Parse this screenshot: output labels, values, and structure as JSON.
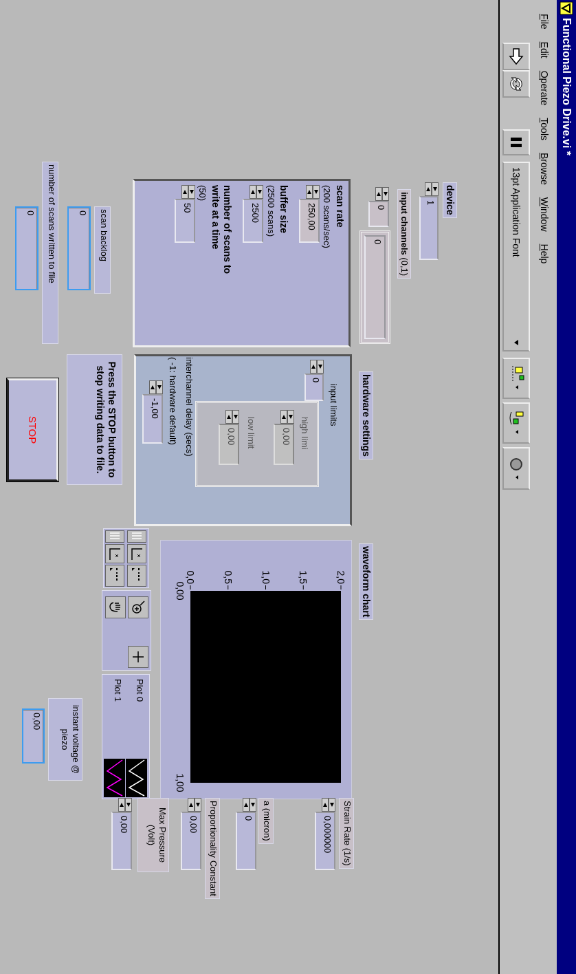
{
  "window": {
    "title": "Functional Piezo Drive.vi *"
  },
  "menu": [
    "File",
    "Edit",
    "Operate",
    "Tools",
    "Browse",
    "Window",
    "Help"
  ],
  "toolbar": {
    "font": "13pt Application Font"
  },
  "device": {
    "label": "device",
    "value": "1"
  },
  "input_channels": {
    "label": "**input channels** (0,1)",
    "index": "0",
    "value": "0"
  },
  "scan_settings": [
    {
      "label": "scan rate",
      "hint": "(200 scans/sec)",
      "value": "250,00"
    },
    {
      "label": "buffer size",
      "hint": "(2500 scans)",
      "value": "2500"
    },
    {
      "label": "number of scans to write at a time",
      "hint": "(50)",
      "value": "50"
    }
  ],
  "hardware_settings": {
    "label": "hardware settings",
    "input_limits": {
      "label": "input limits",
      "index": "0",
      "items": [
        {
          "label": "high limi",
          "value": "0,00",
          "disabled": true
        },
        {
          "label": "low limit",
          "value": "0,00",
          "disabled": true
        }
      ]
    },
    "delay": {
      "label": "interchannel delay (secs)",
      "hint": "( -1: hardware default)",
      "value": "-1,00"
    }
  },
  "note": "Press the STOP button to stop writing data to file.",
  "stop_button": "STOP",
  "indicators": [
    {
      "label": "scan backlog",
      "value": "0"
    },
    {
      "label": "number of scans written to file",
      "value": "0"
    },
    {
      "label": "instant voltage @ piezo",
      "value": "0,00"
    }
  ],
  "chart": {
    "label": "waveform chart",
    "y_axis_labels": [
      "2,0",
      "1,5",
      "1,0",
      "0,5",
      "0,0"
    ],
    "x_axis_labels": [
      "0,00",
      "1,00"
    ],
    "legend": [
      {
        "name": "Plot 0",
        "color": "#ffffff"
      },
      {
        "name": "Plot 1",
        "color": "#ff00ff"
      }
    ]
  },
  "parameters": [
    {
      "label": "Strain Rate (1/s)",
      "value": "0,000000"
    },
    {
      "label": "a (micron)",
      "value": "0"
    },
    {
      "label": "Proportionality Constant",
      "value": "0,00"
    },
    {
      "label": "Max Pressure (Volt)",
      "value": "0,00"
    }
  ]
}
